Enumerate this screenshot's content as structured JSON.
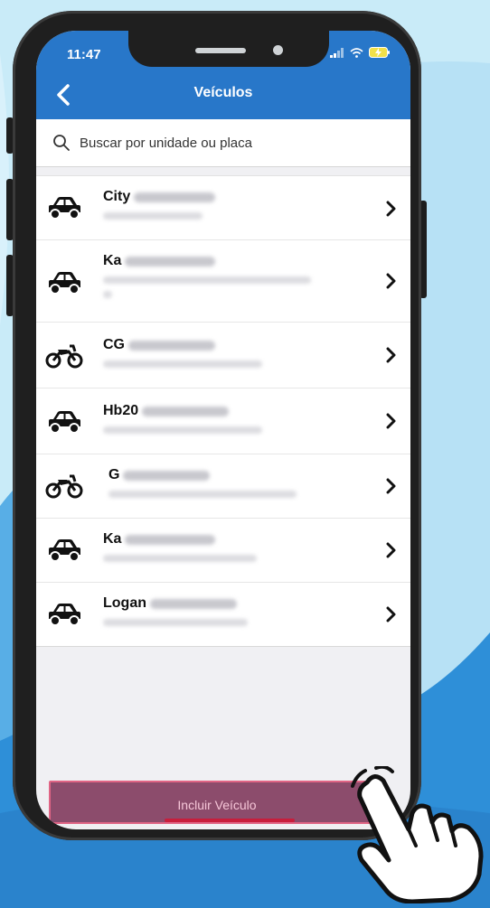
{
  "status_bar": {
    "time": "11:47"
  },
  "header": {
    "title": "Veículos",
    "back_icon": "chevron-left-icon"
  },
  "search": {
    "placeholder": "Buscar por unidade ou placa",
    "icon": "search-icon"
  },
  "vehicles": [
    {
      "model": "City",
      "type": "car"
    },
    {
      "model": "Ka",
      "type": "car"
    },
    {
      "model": "CG",
      "type": "motorcycle"
    },
    {
      "model": "Hb20",
      "type": "car"
    },
    {
      "model": "G",
      "type": "motorcycle"
    },
    {
      "model": "Ka",
      "type": "car"
    },
    {
      "model": "Logan",
      "type": "car"
    }
  ],
  "actions": {
    "include_label": "Incluir Veículo"
  },
  "colors": {
    "header": "#2877c9",
    "button": "#8c4c6c",
    "button_border": "#e06585",
    "background": "#bfe6f7"
  }
}
